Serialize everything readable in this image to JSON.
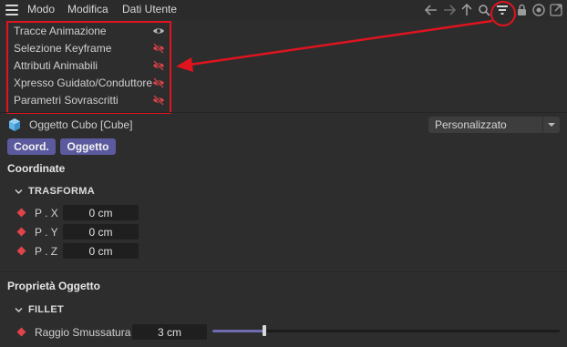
{
  "menubar": {
    "items": [
      "Modo",
      "Modifica",
      "Dati Utente"
    ]
  },
  "toolbar": {
    "icons": [
      "arrow-left-icon",
      "arrow-right-icon",
      "arrow-up-icon",
      "search-icon",
      "filter-icon",
      "lock-icon",
      "target-icon",
      "new-window-icon"
    ]
  },
  "filter_menu": {
    "items": [
      {
        "label": "Tracce Animazione",
        "visible": true
      },
      {
        "label": "Selezione Keyframe",
        "visible": false
      },
      {
        "label": "Attributi Animabili",
        "visible": false
      },
      {
        "label": "Xpresso Guidato/Conduttore",
        "visible": false
      },
      {
        "label": "Parametri Sovrascritti",
        "visible": false
      }
    ]
  },
  "object": {
    "title": "Oggetto Cubo [Cube]",
    "preset": "Personalizzato"
  },
  "tabs": [
    "Coord.",
    "Oggetto"
  ],
  "coordinates": {
    "section_title": "Coordinate",
    "group_title": "TRASFORMA",
    "params": [
      {
        "label": "P . X",
        "value": "0 cm"
      },
      {
        "label": "P . Y",
        "value": "0 cm"
      },
      {
        "label": "P . Z",
        "value": "0 cm"
      }
    ]
  },
  "object_props": {
    "section_title": "Proprietà Oggetto",
    "group_title": "FILLET",
    "fillet_radius": {
      "label": "Raggio Smussatura",
      "value": "3 cm",
      "slider_fraction": 0.15
    }
  },
  "colors": {
    "accent": "#5c5a9e",
    "highlight": "#e0141e",
    "keyframe": "#e0434a"
  }
}
